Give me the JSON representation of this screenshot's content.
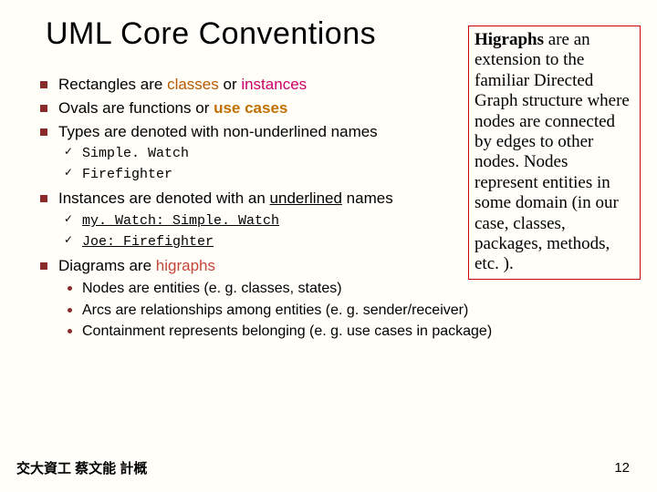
{
  "title": "UML Core Conventions",
  "bullets": {
    "b1a": "Rectangles are ",
    "b1b": "classes",
    "b1c": " or ",
    "b1d": "instances",
    "b2a": "Ovals are functions or ",
    "b2b": "use cases",
    "b3a": "Types are denoted with ",
    "b3b": "non-underlined",
    "b3c": " names",
    "b3s1": "Simple. Watch",
    "b3s2": "Firefighter",
    "b4a": "Instances are denoted with an ",
    "b4b": "underlined",
    "b4c": " names",
    "b4s1": "my. Watch: Simple. Watch",
    "b4s2": "Joe: Firefighter",
    "b5a": "Diagrams are ",
    "b5b": "higraphs",
    "b5s1": "Nodes are entities (e. g. classes, states)",
    "b5s2": "Arcs are relationships among entities (e. g. sender/receiver)",
    "b5s3": "Containment represents belonging (e. g. use cases in package)"
  },
  "callout": {
    "lead": "Higraphs",
    "rest": " are an extension to the familiar Directed Graph structure where nodes are connected by edges to other nodes. Nodes represent entities in some domain (in our case, classes, packages, methods, etc. )."
  },
  "footer": {
    "left": "交大資工 蔡文能 計概",
    "page": "12"
  }
}
